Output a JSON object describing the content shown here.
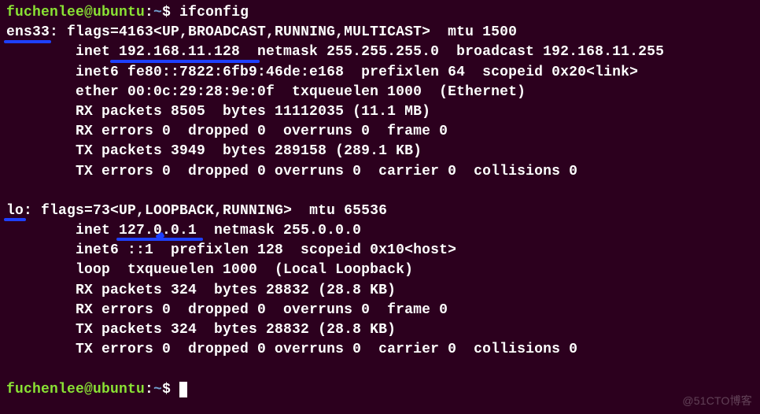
{
  "prompt": {
    "user_host": "fuchenlee@ubuntu",
    "colon": ":",
    "path": "~",
    "dollar": "$ "
  },
  "command": "ifconfig",
  "ens33": {
    "name": "ens33:",
    "line1": " flags=4163<UP,BROADCAST,RUNNING,MULTICAST>  mtu 1500",
    "line2": "        inet 192.168.11.128  netmask 255.255.255.0  broadcast 192.168.11.255",
    "line3": "        inet6 fe80::7822:6fb9:46de:e168  prefixlen 64  scopeid 0x20<link>",
    "line4": "        ether 00:0c:29:28:9e:0f  txqueuelen 1000  (Ethernet)",
    "line5": "        RX packets 8505  bytes 11112035 (11.1 MB)",
    "line6": "        RX errors 0  dropped 0  overruns 0  frame 0",
    "line7": "        TX packets 3949  bytes 289158 (289.1 KB)",
    "line8": "        TX errors 0  dropped 0 overruns 0  carrier 0  collisions 0"
  },
  "lo": {
    "name": "lo:",
    "line1": " flags=73<UP,LOOPBACK,RUNNING>  mtu 65536",
    "line2": "        inet 127.0.0.1  netmask 255.0.0.0",
    "line3": "        inet6 ::1  prefixlen 128  scopeid 0x10<host>",
    "line4": "        loop  txqueuelen 1000  (Local Loopback)",
    "line5": "        RX packets 324  bytes 28832 (28.8 KB)",
    "line6": "        RX errors 0  dropped 0  overruns 0  frame 0",
    "line7": "        TX packets 324  bytes 28832 (28.8 KB)",
    "line8": "        TX errors 0  dropped 0 overruns 0  carrier 0  collisions 0"
  },
  "watermark": "@51CTO博客",
  "annotations": {
    "underline_color": "#1e40ff"
  }
}
